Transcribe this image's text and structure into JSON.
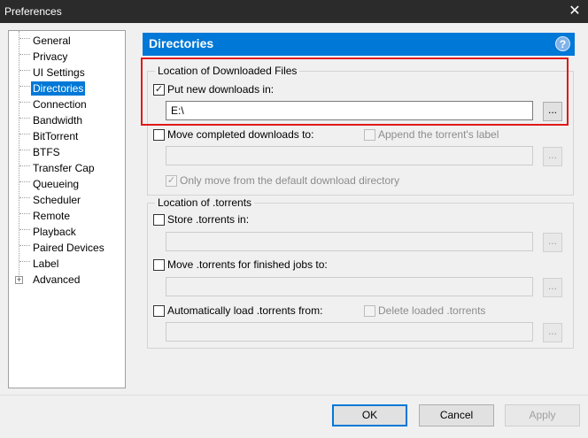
{
  "window": {
    "title": "Preferences",
    "close_glyph": "✕"
  },
  "sidebar": {
    "items": [
      {
        "label": "General"
      },
      {
        "label": "Privacy"
      },
      {
        "label": "UI Settings"
      },
      {
        "label": "Directories"
      },
      {
        "label": "Connection"
      },
      {
        "label": "Bandwidth"
      },
      {
        "label": "BitTorrent"
      },
      {
        "label": "BTFS"
      },
      {
        "label": "Transfer Cap"
      },
      {
        "label": "Queueing"
      },
      {
        "label": "Scheduler"
      },
      {
        "label": "Remote"
      },
      {
        "label": "Playback"
      },
      {
        "label": "Paired Devices"
      },
      {
        "label": "Label"
      },
      {
        "label": "Advanced"
      }
    ],
    "selected": "Directories",
    "expander_glyph": "+"
  },
  "panel": {
    "title": "Directories",
    "help_glyph": "?",
    "downloaded_group": {
      "legend": "Location of Downloaded Files",
      "put_new": {
        "label": "Put new downloads in:",
        "checked": true,
        "check_glyph": "✓"
      },
      "put_new_path": "E:\\",
      "browse_label": "...",
      "move_completed": {
        "label": "Move completed downloads to:",
        "checked": false
      },
      "append_label": {
        "label": "Append the torrent's label",
        "checked": false
      },
      "move_completed_path": "",
      "only_move": {
        "label": "Only move from the default download directory",
        "checked": true,
        "check_glyph": "✓"
      }
    },
    "torrents_group": {
      "legend": "Location of .torrents",
      "store": {
        "label": "Store .torrents in:",
        "checked": false
      },
      "store_path": "",
      "move_finished": {
        "label": "Move .torrents for finished jobs to:",
        "checked": false
      },
      "move_finished_path": "",
      "auto_load": {
        "label": "Automatically load .torrents from:",
        "checked": false
      },
      "delete_loaded": {
        "label": "Delete loaded .torrents",
        "checked": false
      },
      "auto_load_path": ""
    }
  },
  "footer": {
    "ok": "OK",
    "cancel": "Cancel",
    "apply": "Apply"
  },
  "colors": {
    "accent": "#0078d7",
    "highlight_border": "#e11919",
    "titlebar": "#2b2b2b"
  }
}
